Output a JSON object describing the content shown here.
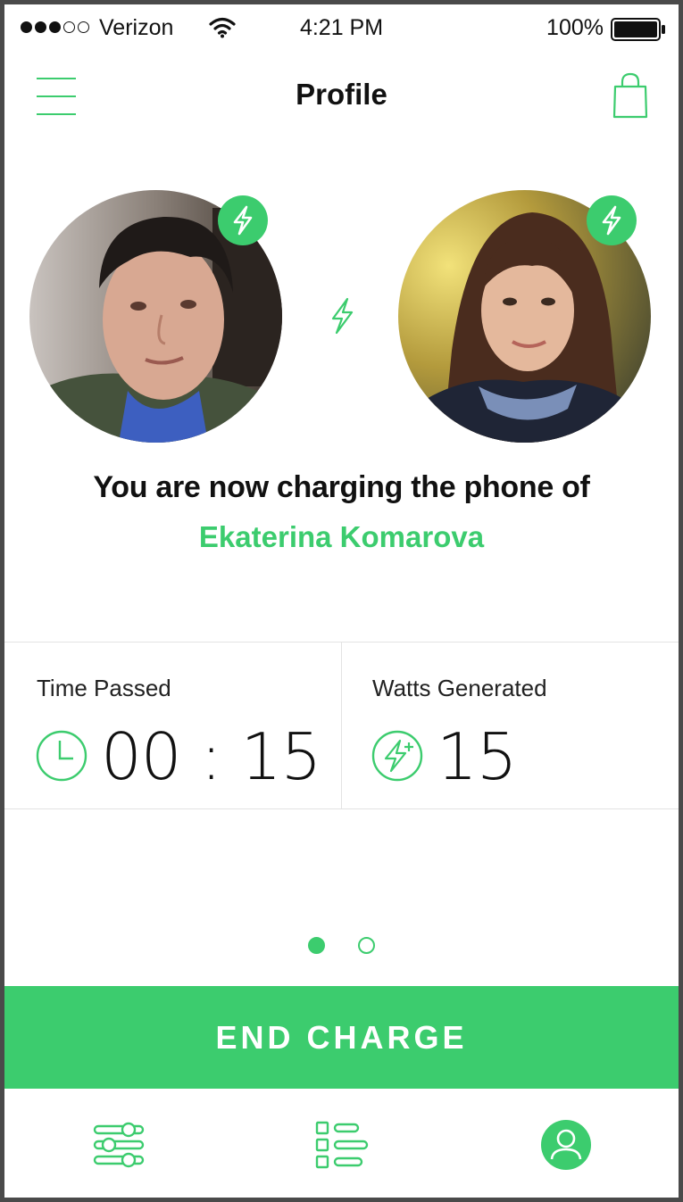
{
  "status_bar": {
    "carrier": "Verizon",
    "time": "4:21 PM",
    "battery": "100%",
    "signal_filled": 3,
    "signal_total": 5
  },
  "nav": {
    "title": "Profile",
    "menu_icon": "hamburger-icon",
    "cart_icon": "shopping-bag-icon"
  },
  "profiles": {
    "me_icon": "lightning-badge-icon",
    "other_icon": "lightning-badge-icon",
    "link_icon": "lightning-icon"
  },
  "message": {
    "line1": "You are now charging the phone of",
    "name": "Ekaterina Komarova"
  },
  "stats": {
    "time_label": "Time Passed",
    "time_value": "00 : 15",
    "watts_label": "Watts Generated",
    "watts_value": "15"
  },
  "pager": {
    "pages": 2,
    "active": 1
  },
  "actions": {
    "end_charge": "END CHARGE"
  },
  "tab_bar": {
    "items": [
      "settings-sliders-icon",
      "list-icon",
      "profile-icon"
    ],
    "active": 2
  },
  "colors": {
    "accent": "#3ccc6e",
    "text": "#111111"
  }
}
